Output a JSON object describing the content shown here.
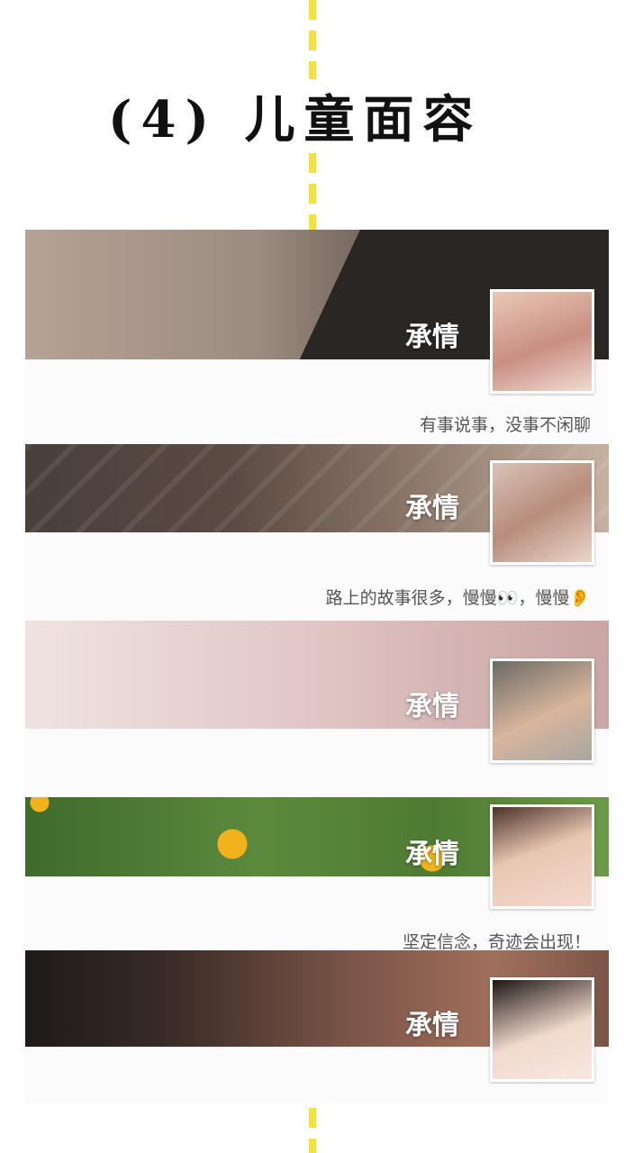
{
  "title": "(4) 儿童面容",
  "cards": [
    {
      "name": "承情",
      "signature": "有事说事，没事不闲聊"
    },
    {
      "name": "承情",
      "signature": "路上的故事很多，慢慢👀，慢慢👂"
    },
    {
      "name": "承情",
      "signature": ""
    },
    {
      "name": "承情",
      "signature": "坚定信念，奇迹会出现！"
    },
    {
      "name": "承情",
      "signature": ""
    }
  ],
  "colors": {
    "accent_dash": "#f7e23a",
    "name_text": "#ffffff",
    "signature_text": "#555555"
  }
}
